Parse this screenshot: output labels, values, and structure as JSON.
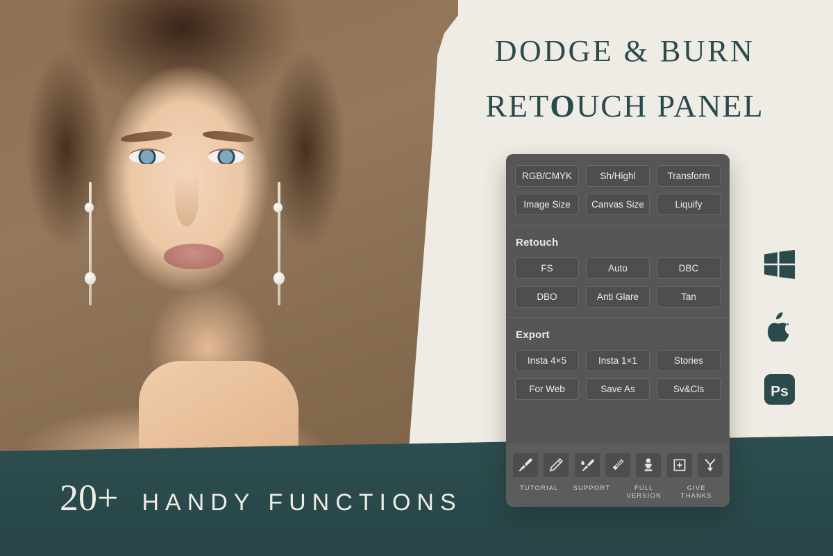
{
  "headline": {
    "line1": "DODGE & BURN",
    "line2_pre": "RET",
    "line2_bold": "O",
    "line2_post": "UCH PANEL"
  },
  "footer": {
    "count": "20+",
    "text": "HANDY FUNCTIONS"
  },
  "platforms": [
    {
      "name": "windows-icon",
      "label": "Windows"
    },
    {
      "name": "apple-icon",
      "label": "Apple"
    },
    {
      "name": "photoshop-icon",
      "label": "Ps"
    }
  ],
  "panel": {
    "top_section": {
      "rows": [
        [
          "RGB/CMYK",
          "Sh/Highl",
          "Transform"
        ],
        [
          "Image Size",
          "Canvas Size",
          "Liquify"
        ]
      ]
    },
    "retouch": {
      "title": "Retouch",
      "rows": [
        [
          "FS",
          "Auto",
          "DBC"
        ],
        [
          "DBO",
          "Anti Glare",
          "Tan"
        ]
      ]
    },
    "export": {
      "title": "Export",
      "rows": [
        [
          "Insta 4×5",
          "Insta 1×1",
          "Stories"
        ],
        [
          "For Web",
          "Save As",
          "Sv&Cls"
        ]
      ]
    },
    "toolbar": {
      "icons": [
        "brush-icon",
        "pencil-icon",
        "mixer-brush-icon",
        "eraser-icon",
        "clone-stamp-icon",
        "new-layer-icon",
        "wishbone-icon"
      ],
      "labels": [
        "TUTORIAL",
        "SUPPORT",
        "FULL VERSION",
        "GIVE THANKS"
      ]
    }
  },
  "colors": {
    "teal": "#2b4a4c",
    "cream": "#efece5",
    "panel_bg": "#565656",
    "button_bg": "#4e4e4e",
    "backdrop_brown": "#8d7154"
  }
}
